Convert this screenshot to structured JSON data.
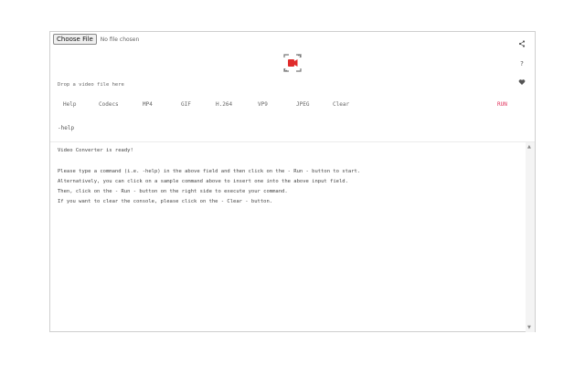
{
  "file_input": {
    "button_label": "Choose File",
    "status": "No file chosen"
  },
  "icons": {
    "logo": "video-convert-icon",
    "side": [
      "share-icon",
      "help-question-icon",
      "favorite-heart-icon"
    ]
  },
  "drop_label": "Drop a video file here",
  "commands": [
    "Help",
    "Codecs",
    "MP4",
    "GIF",
    "H.264",
    "VP9",
    "JPEG",
    "Clear",
    "RUN"
  ],
  "command_input": {
    "value": "-help"
  },
  "console": {
    "lines": [
      "Video Converter is ready!",
      "",
      "Please type a command (i.e. -help) in the above field and then click on the - Run - button to start.",
      "Alternatively, you can click on a sample command above to insert one into the above input field.",
      "Then, click on the - Run - button on the right side to execute your command.",
      "If you want to clear the console, please click on the - Clear - button."
    ]
  },
  "colors": {
    "run": "#e0305a",
    "logo_red": "#e02b2b",
    "logo_frame": "#777777"
  }
}
